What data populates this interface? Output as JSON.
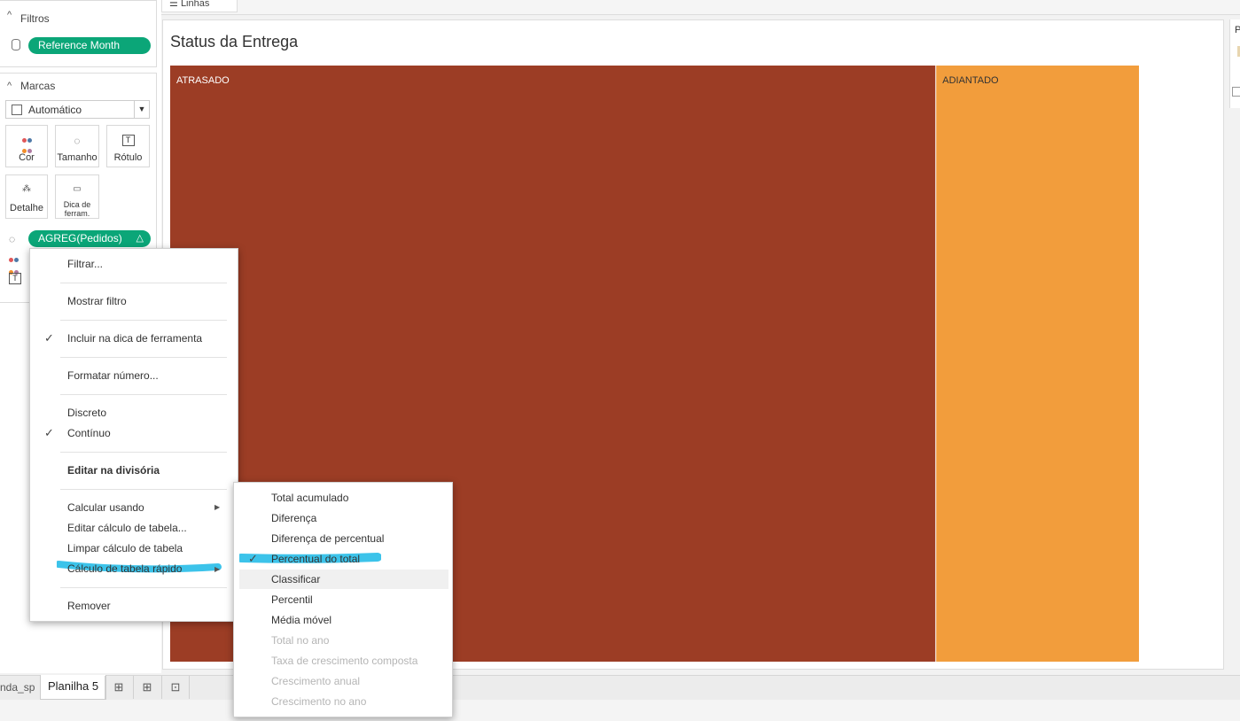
{
  "top_tab": {
    "label": "Linhas"
  },
  "filters": {
    "title": "Filtros",
    "pill": "Reference Month"
  },
  "marks": {
    "title": "Marcas",
    "type_select": "Automático",
    "buttons": {
      "color": "Cor",
      "size": "Tamanho",
      "label": "Rótulo",
      "detail": "Detalhe",
      "tooltip_line1": "Dica de",
      "tooltip_line2": "ferram."
    },
    "size_pill": "AGREG(Pedidos)"
  },
  "sheet": {
    "title": "Status da Entrega"
  },
  "chart_data": {
    "type": "treemap",
    "title": "Status da Entrega",
    "categories": [
      "ATRASADO",
      "ADIANTADO"
    ],
    "values": [
      0.79,
      0.21
    ],
    "colors": [
      "#9c3d25",
      "#f29d3c"
    ]
  },
  "context_menu": {
    "items": [
      "Filtrar...",
      "Mostrar filtro",
      "Incluir na dica de ferramenta",
      "Formatar número...",
      "Discreto",
      "Contínuo",
      "Editar na divisória",
      "Calcular usando",
      "Editar cálculo de tabela...",
      "Limpar cálculo de tabela",
      "Cálculo de tabela rápido",
      "Remover"
    ]
  },
  "submenu": {
    "items": [
      "Total acumulado",
      "Diferença",
      "Diferença de percentual",
      "Percentual do total",
      "Classificar",
      "Percentil",
      "Média móvel",
      "Total no ano",
      "Taxa de crescimento composta",
      "Crescimento anual",
      "Crescimento no ano"
    ]
  },
  "bottom_tabs": {
    "prev_sheet": "nda_sp",
    "active_sheet": "Planilha 5"
  },
  "right_panel": {
    "label": "P"
  },
  "colors": {
    "accent_green": "#0ba678",
    "highlight": "#3cc3ea"
  }
}
